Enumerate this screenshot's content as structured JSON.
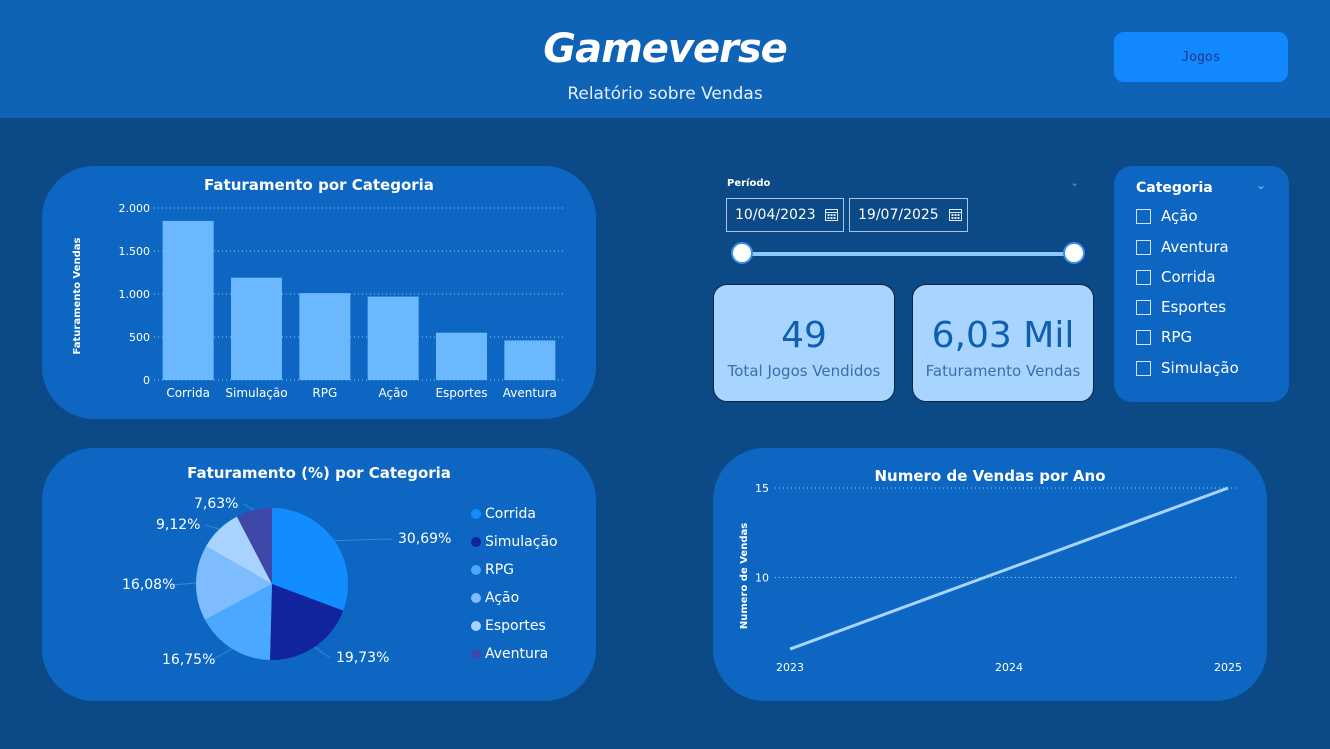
{
  "header": {
    "brand": "Gameverse",
    "subtitle": "Relatório sobre Vendas",
    "nav_button": "Jogos"
  },
  "bar_chart": {
    "title": "Faturamento por Categoria",
    "ylabel": "Faturamento Vendas",
    "y_ticks": [
      "2.000",
      "1.500",
      "1.000",
      "500",
      "0"
    ]
  },
  "pie_chart": {
    "title": "Faturamento (%) por Categoria"
  },
  "line_chart": {
    "title": "Numero de Vendas por Ano",
    "ylabel": "Numero de Vendas",
    "y_ticks": [
      "15",
      "10"
    ]
  },
  "filter": {
    "period_label": "Período",
    "start_date": "10/04/2023",
    "end_date": "19/07/2025",
    "slider_start": 0,
    "slider_end": 1
  },
  "kpis": [
    {
      "value": "49",
      "label": "Total Jogos Vendidos"
    },
    {
      "value": "6,03 Mil",
      "label": "Faturamento Vendas"
    }
  ],
  "category_filter": {
    "title": "Categoria",
    "options": [
      "Ação",
      "Aventura",
      "Corrida",
      "Esportes",
      "RPG",
      "Simulação"
    ]
  },
  "colors": {
    "background": "#0b4a86",
    "header": "#0e63b7",
    "card": "#0d67c2",
    "bar": "#6cb8ff",
    "kpi_bg": "#a8d5ff",
    "line": "#a8d5ff"
  },
  "chart_data": [
    {
      "type": "bar",
      "title": "Faturamento por Categoria",
      "xlabel": "",
      "ylabel": "Faturamento Vendas",
      "categories": [
        "Corrida",
        "Simulação",
        "RPG",
        "Ação",
        "Esportes",
        "Aventura"
      ],
      "values": [
        1850,
        1190,
        1010,
        970,
        550,
        460
      ],
      "ylim": [
        0,
        2000
      ],
      "grid": true
    },
    {
      "type": "pie",
      "title": "Faturamento (%) por Categoria",
      "categories": [
        "Corrida",
        "Simulação",
        "RPG",
        "Ação",
        "Esportes",
        "Aventura"
      ],
      "values": [
        30.69,
        19.73,
        16.75,
        16.08,
        9.12,
        7.63
      ],
      "labels": [
        "30,69%",
        "19,73%",
        "16,75%",
        "16,08%",
        "9,12%",
        "7,63%"
      ],
      "colors": [
        "#118dff",
        "#12239e",
        "#4aa8ff",
        "#7cbcff",
        "#a8d3ff",
        "#3f48a8"
      ],
      "legend": "right"
    },
    {
      "type": "line",
      "title": "Numero de Vendas por Ano",
      "xlabel": "",
      "ylabel": "Numero de Vendas",
      "x": [
        "2023",
        "2024",
        "2025"
      ],
      "values": [
        6,
        10.5,
        15
      ],
      "ylim": [
        5.5,
        15
      ],
      "grid": true
    }
  ]
}
